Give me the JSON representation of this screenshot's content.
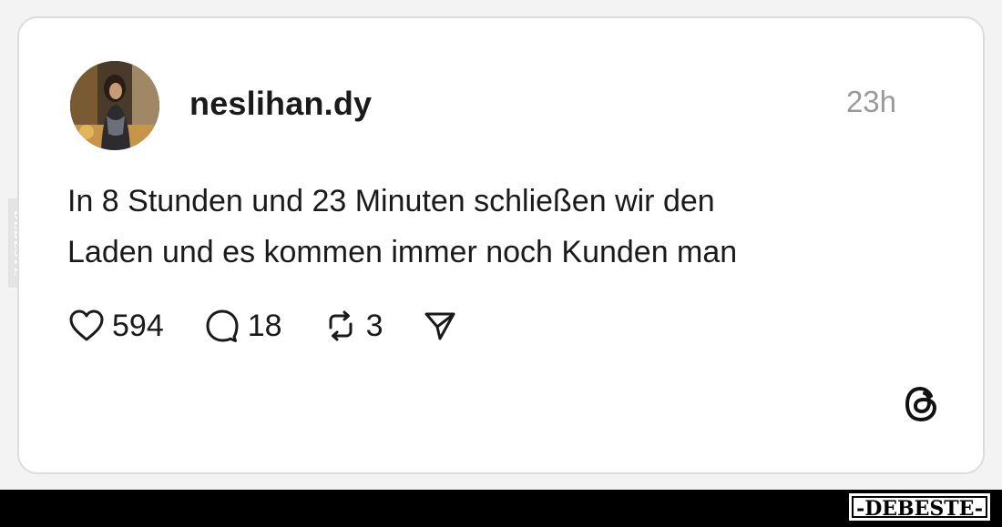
{
  "post": {
    "username": "neslihan.dy",
    "timestamp": "23h",
    "text_line_1": "In 8 Stunden und 23 Minuten schließen wir den",
    "text_line_2": "Laden und es kommen immer noch Kunden man",
    "avatar_icon": "profile-photo",
    "actions": {
      "like_count": "594",
      "reply_count": "18",
      "repost_count": "3",
      "like_icon": "heart-icon",
      "reply_icon": "speech-bubble-icon",
      "repost_icon": "repost-icon",
      "share_icon": "send-icon"
    },
    "platform_icon": "threads-logo-icon"
  },
  "watermark": {
    "side_text": "DEBESTE",
    "bottom_text": "-DEBESTE-"
  },
  "colors": {
    "text": "#1a1a1a",
    "muted": "#9a9a9a",
    "card_border": "#dcdcdc",
    "bar": "#000000"
  }
}
